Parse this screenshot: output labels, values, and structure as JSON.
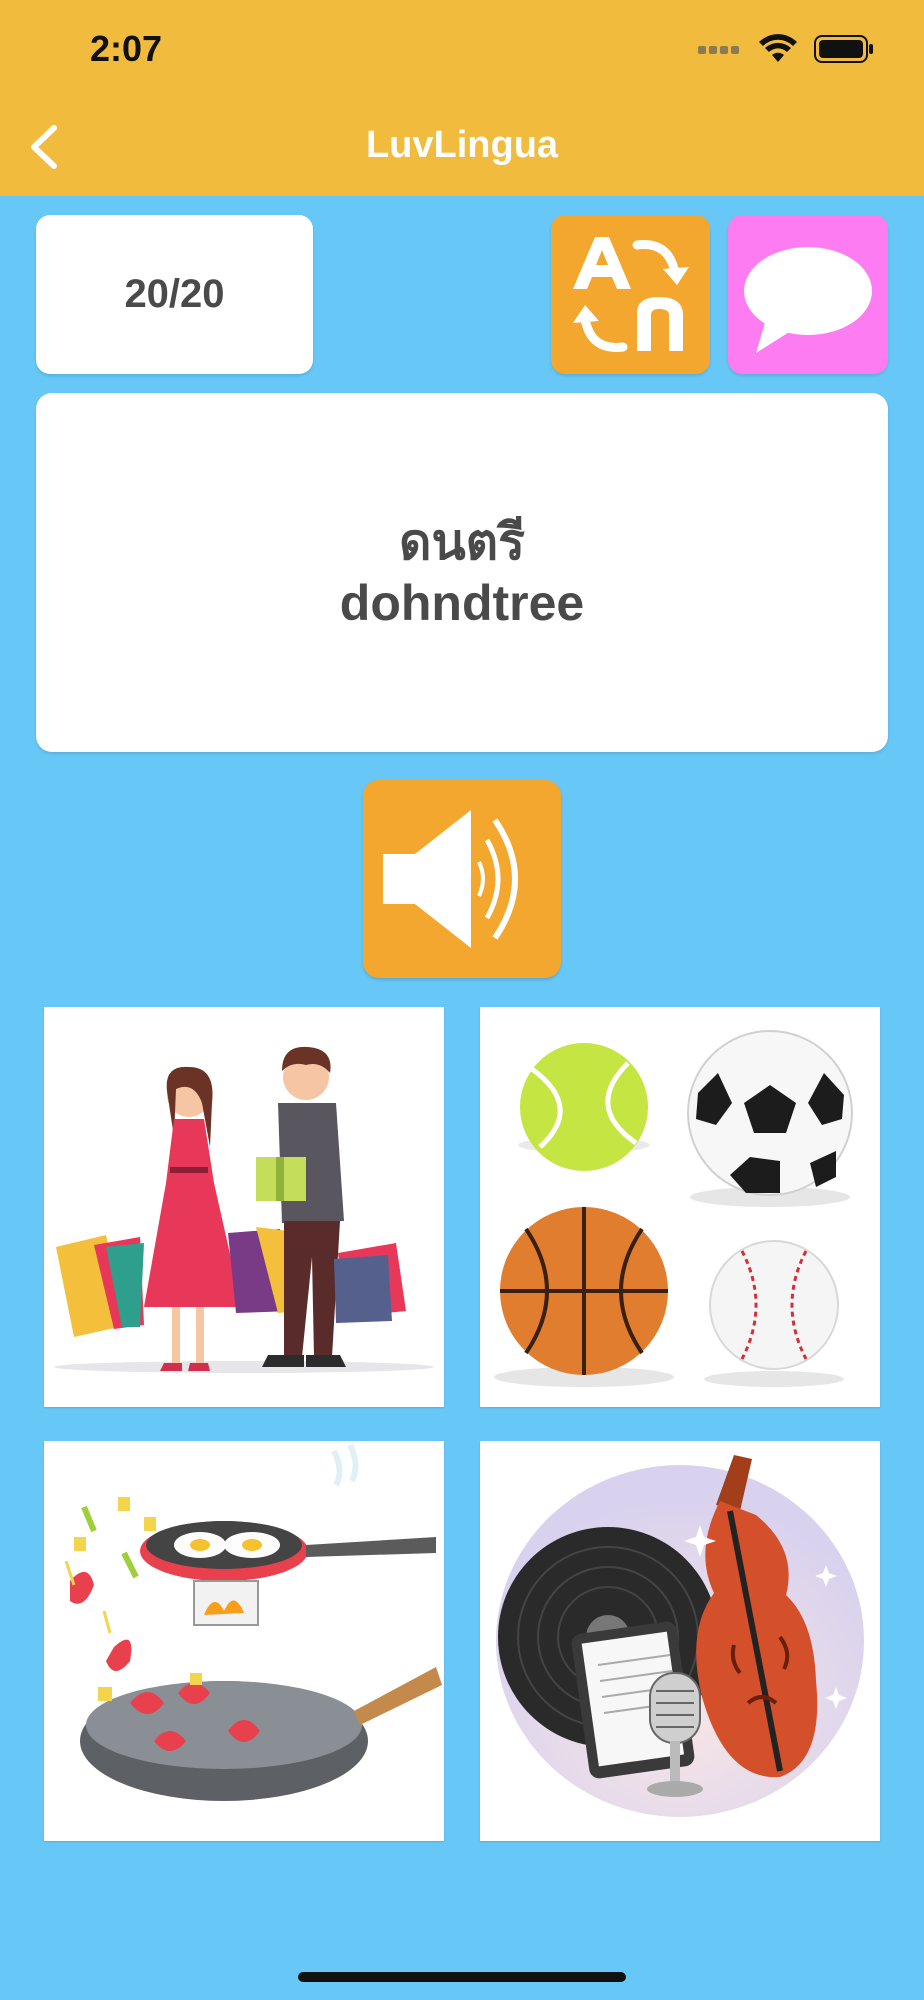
{
  "status_bar": {
    "time": "2:07"
  },
  "nav": {
    "title": "LuvLingua",
    "back_icon": "chevron-left-icon"
  },
  "quiz": {
    "counter": "20/20",
    "word_native": "ดนตรี",
    "word_romanized": "dohndtree"
  },
  "actions": {
    "translate_icon": "translate-icon",
    "chat_icon": "speech-bubble-icon",
    "speaker_icon": "speaker-icon"
  },
  "choices": [
    {
      "icon": "shopping-couple-image"
    },
    {
      "icon": "sports-balls-image"
    },
    {
      "icon": "cooking-pans-image"
    },
    {
      "icon": "music-instruments-image"
    }
  ],
  "colors": {
    "background": "#67c8f8",
    "header": "#f1bb3d",
    "orange_button": "#f4a72e",
    "pink_button": "#fd7cf2",
    "text": "#4a4a4a"
  }
}
